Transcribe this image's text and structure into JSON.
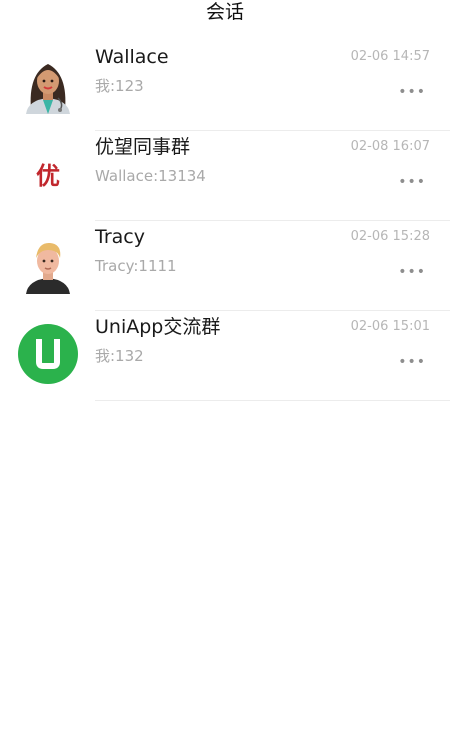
{
  "header": {
    "title": "会话"
  },
  "conversations": [
    {
      "name": "Wallace",
      "last_message": "我:123",
      "time": "02-06 14:57",
      "more": "•••",
      "avatar": "wallace-avatar"
    },
    {
      "name": "优望同事群",
      "last_message": "Wallace:13134",
      "time": "02-08 16:07",
      "more": "•••",
      "avatar": "group-logo",
      "avatar_text": "优",
      "avatar_color": "#c1272d"
    },
    {
      "name": "Tracy",
      "last_message": "Tracy:1111",
      "time": "02-06 15:28",
      "more": "•••",
      "avatar": "tracy-avatar"
    },
    {
      "name": "UniApp交流群",
      "last_message": "我:132",
      "time": "02-06 15:01",
      "more": "•••",
      "avatar": "uniapp-logo",
      "avatar_text": "U",
      "avatar_color": "#2bb24c"
    }
  ]
}
